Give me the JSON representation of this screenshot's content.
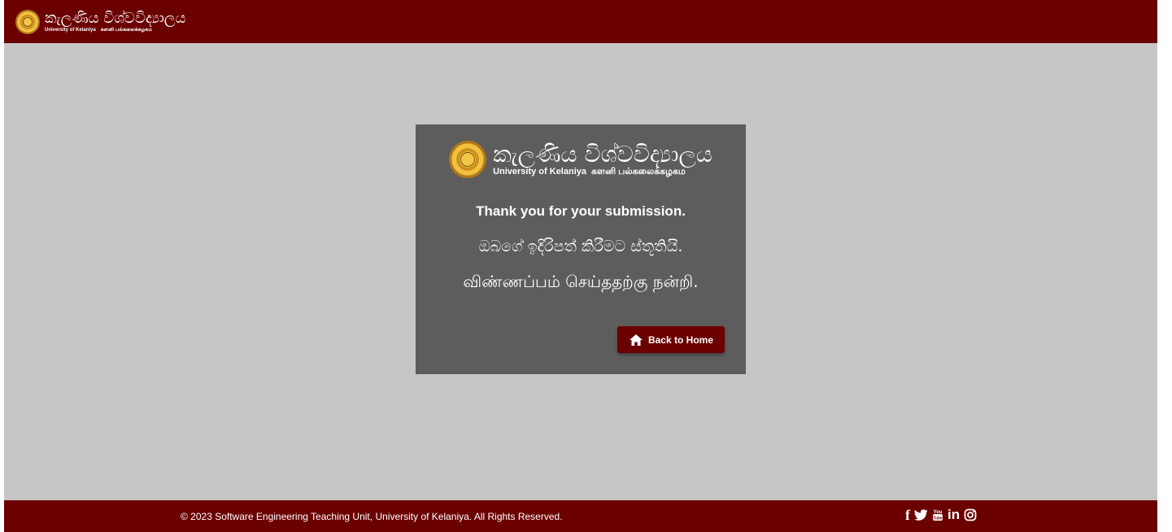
{
  "header": {
    "logo_sinhala": "කැලණිය විශ්වවිද්‍යාලය",
    "logo_english": "University of Kelaniya",
    "logo_tamil": "களனி பல்கலைக்கழகம"
  },
  "card": {
    "logo_sinhala": "කැලණිය විශ්වවිද්‍යාලය",
    "logo_english": "University of Kelaniya",
    "logo_tamil": "களனி பல்கலைக்கழகம",
    "message_english": "Thank you for your submission.",
    "message_sinhala": "ඔබගේ ඉදිරිපත් කිරීමට ස්තූතියි.",
    "message_tamil": "விண்ணப்பம் செய்ததற்கு நன்றி.",
    "button_label": "Back to Home"
  },
  "footer": {
    "copyright": "© 2023 Software Engineering Teaching Unit, University of Kelaniya. All Rights Reserved.",
    "social_icons": [
      "facebook-icon",
      "twitter-icon",
      "youtube-icon",
      "linkedin-icon",
      "instagram-icon"
    ]
  },
  "colors": {
    "brand_maroon": "#6b0000",
    "page_background": "#c6c6c6",
    "card_background": "#5d5d5d"
  }
}
